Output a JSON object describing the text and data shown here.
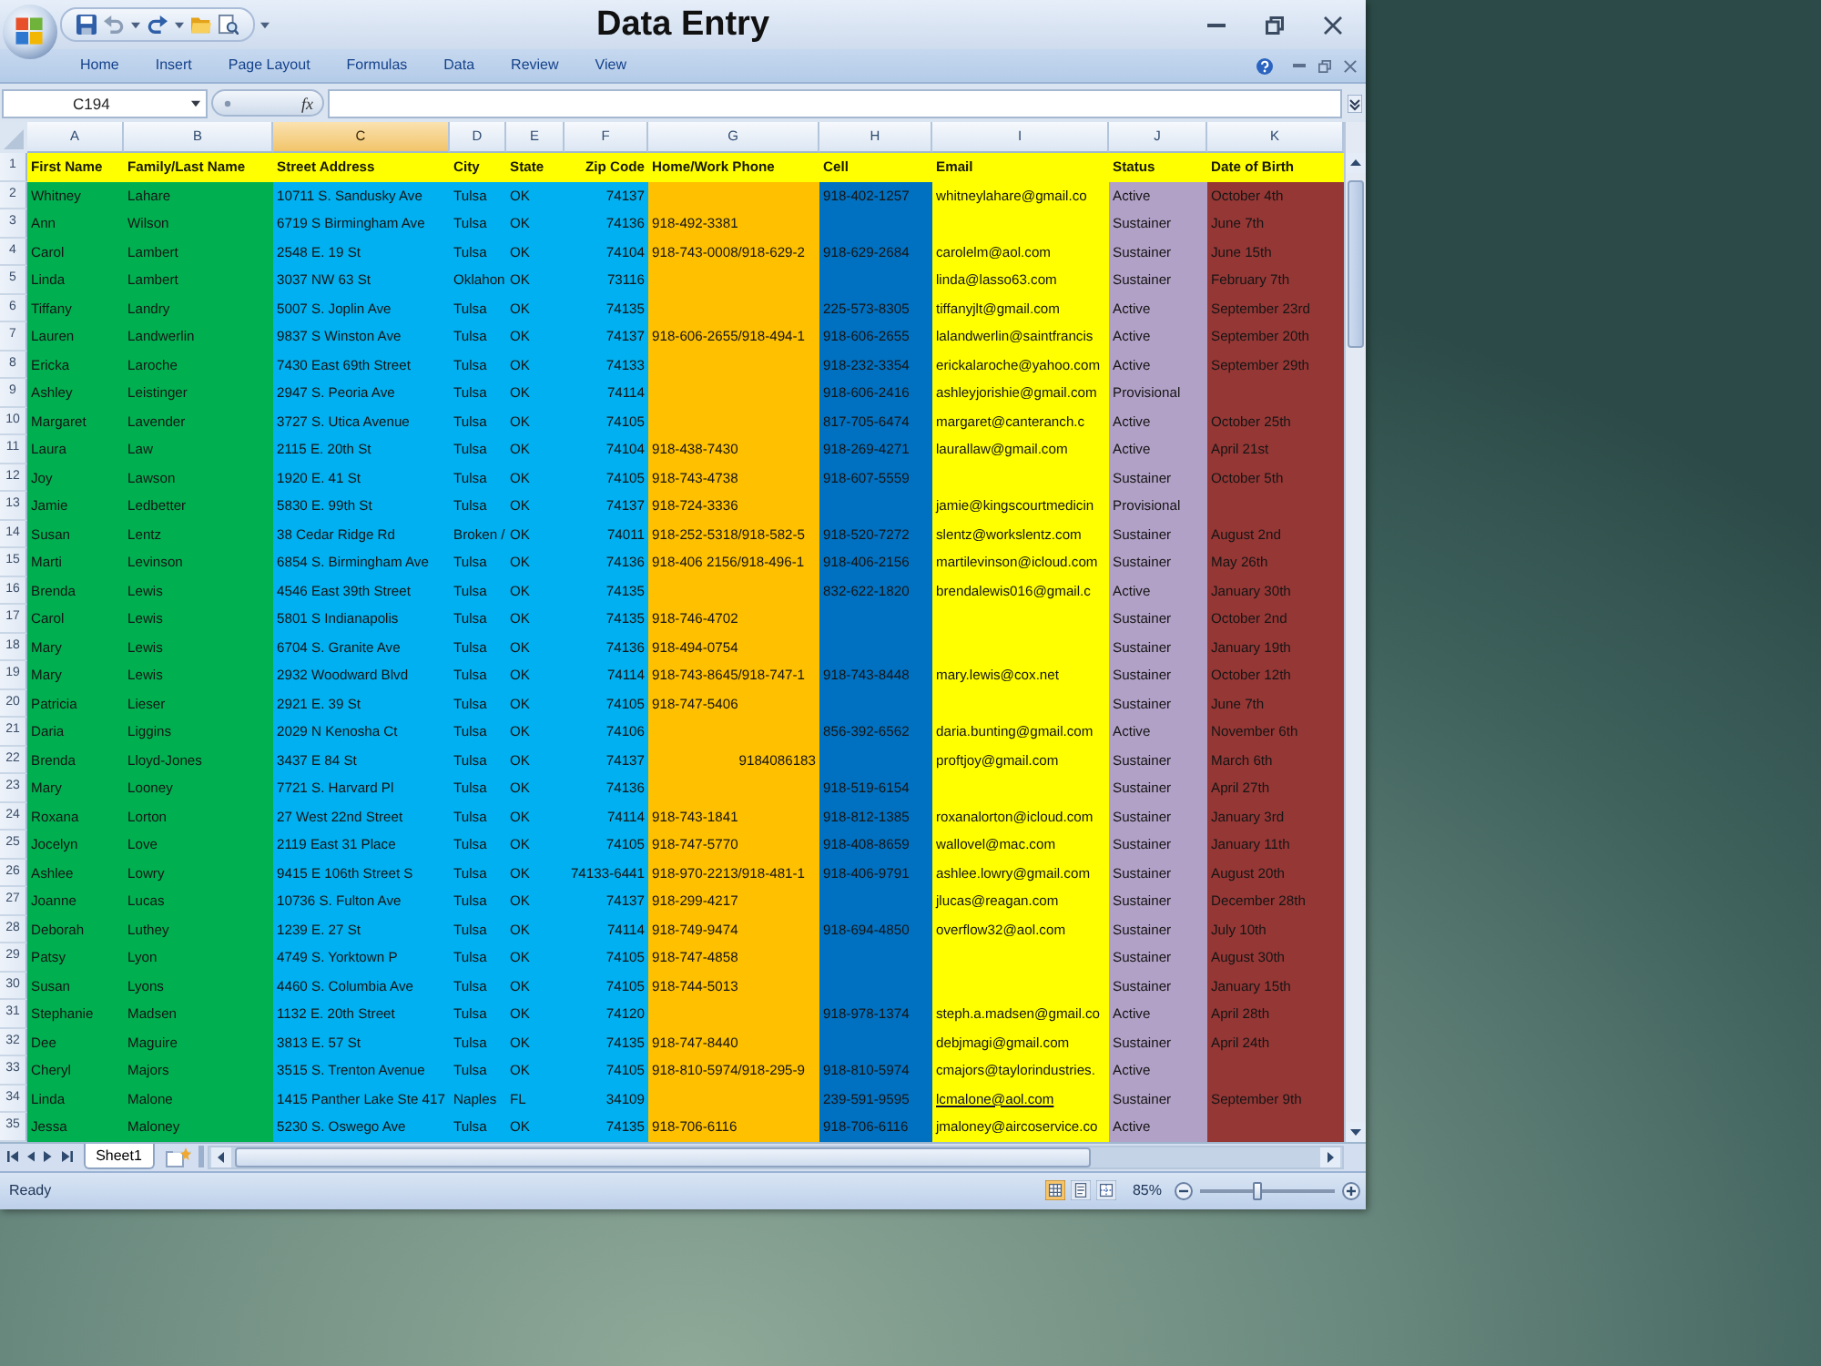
{
  "window": {
    "title": "Data Entry"
  },
  "ribbon": {
    "tabs": [
      "Home",
      "Insert",
      "Page Layout",
      "Formulas",
      "Data",
      "Review",
      "View"
    ]
  },
  "formula_bar": {
    "name_box": "C194",
    "function_button": "fx"
  },
  "sheet": {
    "columns": [
      {
        "letter": "A",
        "color": "#00b050",
        "kind": "text",
        "selected": false
      },
      {
        "letter": "B",
        "color": "#00b050",
        "kind": "text",
        "selected": false
      },
      {
        "letter": "C",
        "color": "#00b0f0",
        "kind": "text",
        "selected": true
      },
      {
        "letter": "D",
        "color": "#00b0f0",
        "kind": "text",
        "selected": false
      },
      {
        "letter": "E",
        "color": "#00b0f0",
        "kind": "text",
        "selected": false
      },
      {
        "letter": "F",
        "color": "#00b0f0",
        "kind": "number",
        "selected": false
      },
      {
        "letter": "G",
        "color": "#ffc000",
        "kind": "text",
        "selected": false
      },
      {
        "letter": "H",
        "color": "#0070c0",
        "kind": "text",
        "selected": false
      },
      {
        "letter": "I",
        "color": "#ffff00",
        "kind": "text",
        "selected": false
      },
      {
        "letter": "J",
        "color": "#b2a1c7",
        "kind": "text",
        "selected": false
      },
      {
        "letter": "K",
        "color": "#953735",
        "kind": "text",
        "selected": false
      }
    ],
    "rows": [
      {
        "number": "1",
        "kind": "header",
        "cells": [
          "First Name",
          "Family/Last Name",
          "Street Address",
          "City",
          "State",
          "Zip Code",
          "Home/Work Phone",
          "Cell",
          "Email",
          "Status",
          "Date of Birth"
        ]
      },
      {
        "number": "2",
        "kind": "data",
        "cells": [
          "Whitney",
          "Lahare",
          "10711 S. Sandusky Ave",
          "Tulsa",
          "OK",
          "74137",
          null,
          "918-402-1257",
          "whitneylahare@gmail.co",
          "Active",
          "October 4th"
        ]
      },
      {
        "number": "3",
        "kind": "data",
        "cells": [
          "Ann",
          "Wilson",
          "6719 S Birmingham Ave",
          "Tulsa",
          "OK",
          "74136",
          "918-492-3381",
          null,
          null,
          "Sustainer",
          "June 7th"
        ]
      },
      {
        "number": "4",
        "kind": "data",
        "cells": [
          "Carol",
          "Lambert",
          "2548 E. 19 St",
          "Tulsa",
          "OK",
          "74104",
          "918-743-0008/918-629-2",
          "918-629-2684",
          "carolelm@aol.com",
          "Sustainer",
          "June 15th"
        ]
      },
      {
        "number": "5",
        "kind": "data",
        "cells": [
          "Linda",
          "Lambert",
          "3037 NW 63 St",
          "Oklahon",
          "OK",
          "73116",
          null,
          null,
          "linda@lasso63.com",
          "Sustainer",
          "February 7th"
        ]
      },
      {
        "number": "6",
        "kind": "data",
        "cells": [
          "Tiffany",
          "Landry",
          "5007 S. Joplin Ave",
          "Tulsa",
          "OK",
          "74135",
          null,
          "225-573-8305",
          "tiffanyjlt@gmail.com",
          "Active",
          "September 23rd"
        ]
      },
      {
        "number": "7",
        "kind": "data",
        "cells": [
          "Lauren",
          "Landwerlin",
          "9837 S Winston Ave",
          "Tulsa",
          "OK",
          "74137",
          "918-606-2655/918-494-1",
          "918-606-2655",
          "lalandwerlin@saintfrancis",
          "Active",
          "September 20th"
        ]
      },
      {
        "number": "8",
        "kind": "data",
        "cells": [
          "Ericka",
          "Laroche",
          "7430 East 69th Street",
          "Tulsa",
          "OK",
          "74133",
          null,
          "918-232-3354",
          "erickalaroche@yahoo.com",
          "Active",
          "September 29th"
        ]
      },
      {
        "number": "9",
        "kind": "data",
        "cells": [
          "Ashley",
          "Leistinger",
          "2947 S. Peoria Ave",
          "Tulsa",
          "OK",
          "74114",
          null,
          "918-606-2416",
          "ashleyjorishie@gmail.com",
          "Provisional",
          null
        ]
      },
      {
        "number": "10",
        "kind": "data",
        "cells": [
          "Margaret",
          "Lavender",
          "3727 S. Utica Avenue",
          "Tulsa",
          "OK",
          "74105",
          null,
          "817-705-6474",
          "margaret@canteranch.c",
          "Active",
          "October 25th"
        ]
      },
      {
        "number": "11",
        "kind": "data",
        "cells": [
          "Laura",
          "Law",
          "2115 E. 20th St",
          "Tulsa",
          "OK",
          "74104",
          "918-438-7430",
          "918-269-4271",
          "laurallaw@gmail.com",
          "Active",
          "April 21st"
        ]
      },
      {
        "number": "12",
        "kind": "data",
        "cells": [
          "Joy",
          "Lawson",
          "1920 E. 41 St",
          "Tulsa",
          "OK",
          "74105",
          "918-743-4738",
          "918-607-5559",
          null,
          "Sustainer",
          "October 5th"
        ]
      },
      {
        "number": "13",
        "kind": "data",
        "cells": [
          "Jamie",
          "Ledbetter",
          "5830 E. 99th St",
          "Tulsa",
          "OK",
          "74137",
          "918-724-3336",
          null,
          "jamie@kingscourtmedicin",
          "Provisional",
          null
        ]
      },
      {
        "number": "14",
        "kind": "data",
        "cells": [
          "Susan",
          "Lentz",
          "38 Cedar Ridge Rd",
          "Broken /",
          "OK",
          "74011",
          "918-252-5318/918-582-5",
          "918-520-7272",
          "slentz@workslentz.com",
          "Sustainer",
          "August 2nd"
        ]
      },
      {
        "number": "15",
        "kind": "data",
        "cells": [
          "Marti",
          "Levinson",
          "6854 S. Birmingham Ave",
          "Tulsa",
          "OK",
          "74136",
          "918-406 2156/918-496-1",
          "918-406-2156",
          "martilevinson@icloud.com",
          "Sustainer",
          "May 26th"
        ]
      },
      {
        "number": "16",
        "kind": "data",
        "cells": [
          "Brenda",
          "Lewis",
          "4546 East 39th Street",
          "Tulsa",
          "OK",
          "74135",
          null,
          "832-622-1820",
          "brendalewis016@gmail.c",
          "Active",
          "January 30th"
        ]
      },
      {
        "number": "17",
        "kind": "data",
        "cells": [
          "Carol",
          "Lewis",
          "5801 S Indianapolis",
          "Tulsa",
          "OK",
          "74135",
          "918-746-4702",
          null,
          null,
          "Sustainer",
          "October 2nd"
        ]
      },
      {
        "number": "18",
        "kind": "data",
        "cells": [
          "Mary",
          "Lewis",
          "6704 S. Granite Ave",
          "Tulsa",
          "OK",
          "74136",
          "918-494-0754",
          null,
          null,
          "Sustainer",
          "January 19th"
        ]
      },
      {
        "number": "19",
        "kind": "data",
        "cells": [
          "Mary",
          "Lewis",
          "2932 Woodward Blvd",
          "Tulsa",
          "OK",
          "74114",
          "918-743-8645/918-747-1",
          "918-743-8448",
          "mary.lewis@cox.net",
          "Sustainer",
          "October 12th"
        ]
      },
      {
        "number": "20",
        "kind": "data",
        "cells": [
          "Patricia",
          "Lieser",
          "2921 E. 39 St",
          "Tulsa",
          "OK",
          "74105",
          "918-747-5406",
          null,
          null,
          "Sustainer",
          "June 7th"
        ]
      },
      {
        "number": "21",
        "kind": "data",
        "cells": [
          "Daria",
          "Liggins",
          "2029 N Kenosha Ct",
          "Tulsa",
          "OK",
          "74106",
          null,
          "856-392-6562",
          "daria.bunting@gmail.com",
          "Active",
          "November 6th"
        ]
      },
      {
        "number": "22",
        "kind": "data",
        "cells": [
          "Brenda",
          "Lloyd-Jones",
          "3437 E 84 St",
          "Tulsa",
          "OK",
          "74137",
          {
            "text": "9184086183",
            "kind": "number"
          },
          null,
          "proftjoy@gmail.com",
          "Sustainer",
          "March 6th"
        ]
      },
      {
        "number": "23",
        "kind": "data",
        "cells": [
          "Mary",
          "Looney",
          "7721 S. Harvard Pl",
          "Tulsa",
          "OK",
          "74136",
          null,
          "918-519-6154",
          null,
          "Sustainer",
          "April 27th"
        ]
      },
      {
        "number": "24",
        "kind": "data",
        "cells": [
          "Roxana",
          "Lorton",
          "27 West 22nd Street",
          "Tulsa",
          "OK",
          "74114",
          "918-743-1841",
          "918-812-1385",
          "roxanalorton@icloud.com",
          "Sustainer",
          "January 3rd"
        ]
      },
      {
        "number": "25",
        "kind": "data",
        "cells": [
          "Jocelyn",
          "Love",
          "2119 East 31 Place",
          "Tulsa",
          "OK",
          "74105",
          "918-747-5770",
          "918-408-8659",
          "wallovel@mac.com",
          "Sustainer",
          "January 11th"
        ]
      },
      {
        "number": "26",
        "kind": "data",
        "cells": [
          "Ashlee",
          "Lowry",
          "9415 E 106th Street S",
          "Tulsa",
          "OK",
          "74133-6441",
          "918-970-2213/918-481-1",
          "918-406-9791",
          "ashlee.lowry@gmail.com",
          "Sustainer",
          "August 20th"
        ]
      },
      {
        "number": "27",
        "kind": "data",
        "cells": [
          "Joanne",
          "Lucas",
          "10736 S. Fulton Ave",
          "Tulsa",
          "OK",
          "74137",
          "918-299-4217",
          null,
          "jlucas@reagan.com",
          "Sustainer",
          "December 28th"
        ]
      },
      {
        "number": "28",
        "kind": "data",
        "cells": [
          "Deborah",
          "Luthey",
          "1239 E. 27 St",
          "Tulsa",
          "OK",
          "74114",
          "918-749-9474",
          "918-694-4850",
          "overflow32@aol.com",
          "Sustainer",
          "July 10th"
        ]
      },
      {
        "number": "29",
        "kind": "data",
        "cells": [
          "Patsy",
          "Lyon",
          "4749 S. Yorktown P",
          "Tulsa",
          "OK",
          "74105",
          "918-747-4858",
          null,
          null,
          "Sustainer",
          "August 30th"
        ]
      },
      {
        "number": "30",
        "kind": "data",
        "cells": [
          "Susan",
          "Lyons",
          "4460 S. Columbia Ave",
          "Tulsa",
          "OK",
          "74105",
          "918-744-5013",
          null,
          null,
          "Sustainer",
          "January 15th"
        ]
      },
      {
        "number": "31",
        "kind": "data",
        "cells": [
          "Stephanie",
          "Madsen",
          "1132 E. 20th Street",
          "Tulsa",
          "OK",
          "74120",
          null,
          "918-978-1374",
          "steph.a.madsen@gmail.co",
          "Active",
          "April 28th"
        ]
      },
      {
        "number": "32",
        "kind": "data",
        "cells": [
          "Dee",
          "Maguire",
          "3813 E. 57 St",
          "Tulsa",
          "OK",
          "74135",
          "918-747-8440",
          null,
          "debjmagi@gmail.com",
          "Sustainer",
          "April 24th"
        ]
      },
      {
        "number": "33",
        "kind": "data",
        "cells": [
          "Cheryl",
          "Majors",
          "3515 S. Trenton Avenue",
          "Tulsa",
          "OK",
          "74105",
          "918-810-5974/918-295-9",
          "918-810-5974",
          "cmajors@taylorindustries.",
          "Active",
          null
        ]
      },
      {
        "number": "34",
        "kind": "data",
        "cells": [
          "Linda",
          "Malone",
          "1415 Panther Lake Ste 417",
          "Naples",
          "FL",
          "34109",
          null,
          "239-591-9595",
          {
            "text": "lcmalone@aol.com",
            "kind": "link"
          },
          "Sustainer",
          "September 9th"
        ]
      },
      {
        "number": "35",
        "kind": "data",
        "cells": [
          "Jessa",
          "Maloney",
          "5230 S. Oswego Ave",
          "Tulsa",
          "OK",
          "74135",
          "918-706-6116",
          "918-706-6116",
          "jmaloney@aircoservice.co",
          "Active",
          null
        ]
      }
    ]
  },
  "sheet_tabs": [
    {
      "label": "Sheet1",
      "selected": true
    }
  ],
  "status_bar": {
    "text": "Ready",
    "views": [
      {
        "kind": "normal",
        "selected": true
      },
      {
        "kind": "page_layout",
        "selected": false
      },
      {
        "kind": "page_break",
        "selected": false
      }
    ],
    "zoom": "85%",
    "zoom_slider": {
      "level": 0.42
    }
  }
}
